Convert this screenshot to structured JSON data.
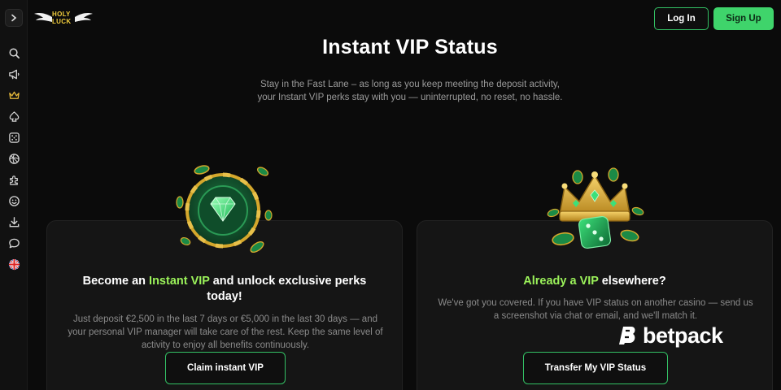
{
  "brand": {
    "logo_line1": "HOLY",
    "logo_line2": "LUCK"
  },
  "sidebar": {
    "icons": [
      "search-icon",
      "megaphone-icon",
      "crown-icon",
      "spade-icon",
      "dice-icon",
      "sports-ball-icon",
      "puzzle-icon",
      "smiley-icon",
      "download-icon",
      "chat-icon",
      "uk-flag-icon"
    ]
  },
  "header": {
    "login_label": "Log In",
    "signup_label": "Sign Up"
  },
  "hero": {
    "title": "Instant VIP Status",
    "subtitle": "Stay in the Fast Lane – as long as you keep meeting the deposit activity, your Instant VIP perks stay with you — uninterrupted, no reset, no hassle."
  },
  "instant_vip_card": {
    "heading_pre": "Become an ",
    "heading_accent": "Instant VIP",
    "heading_post": " and unlock exclusive perks today!",
    "text": "Just deposit €2,500 in the last 7 days or €5,000 in the last 30 days — and your personal VIP manager will take care of the rest. Keep the same level of activity to enjoy all benefits continuously.",
    "button_label": "Claim instant VIP"
  },
  "transfer_card": {
    "heading_accent": "Already a VIP",
    "heading_post": " elsewhere?",
    "text": "We've got you covered. If you have VIP status on another casino — send us a screenshot via chat or email, and we'll match it.",
    "button_label": "Transfer My VIP Status"
  },
  "watermark": {
    "text": "betpack"
  },
  "colors": {
    "accent_green": "#3fd46b",
    "heading_accent": "#9bf25a",
    "background": "#0b0b0b",
    "gold": "#f4d03f"
  }
}
